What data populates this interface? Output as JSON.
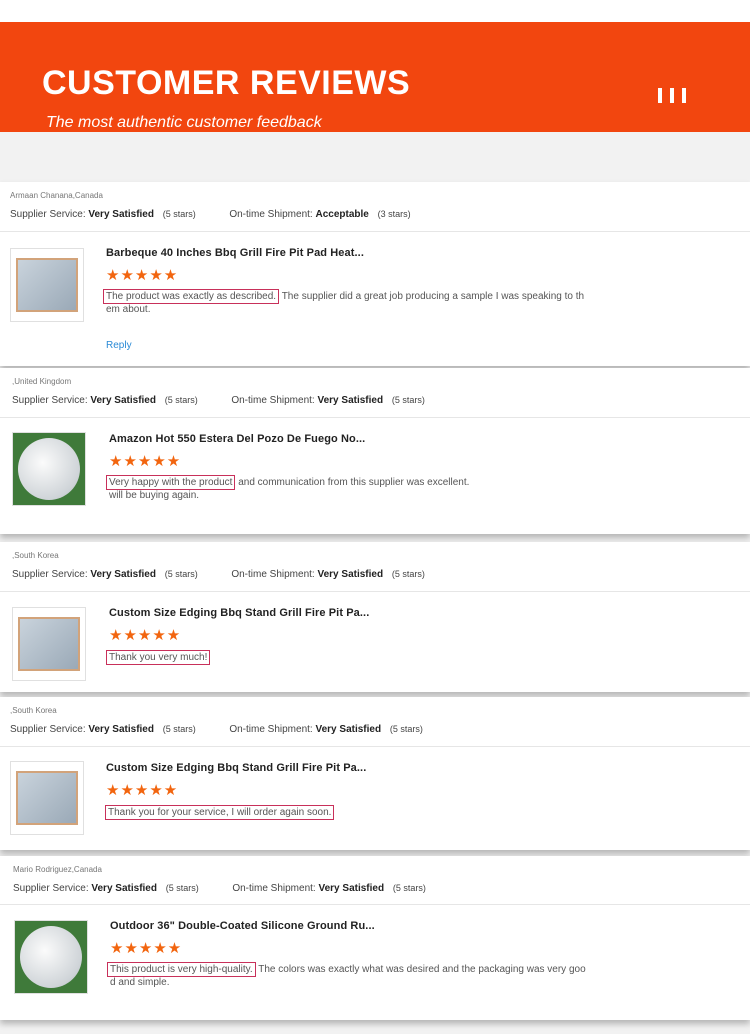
{
  "header": {
    "title": "CUSTOMER REVIEWS",
    "subtitle": "The most authentic customer feedback"
  },
  "labels": {
    "supplier_service": "Supplier Service:",
    "ontime_shipment": "On-time Shipment:"
  },
  "reviews": [
    {
      "reviewer": "Armaan Chanana,Canada",
      "supplier_rating": "Very Satisfied",
      "supplier_stars": "(5 stars)",
      "shipment_rating": "Acceptable",
      "shipment_stars": "(3 stars)",
      "product_title": "Barbeque 40 Inches Bbq Grill Fire Pit Pad Heat...",
      "stars": 5,
      "highlight": "The product was exactly as described.",
      "text_rest": " The supplier did a great job producing a sample I was speaking to th",
      "text_line2": "em about.",
      "reply_label": "Reply",
      "thumb": "square-mat-icon"
    },
    {
      "reviewer": ",United Kingdom",
      "supplier_rating": "Very Satisfied",
      "supplier_stars": "(5 stars)",
      "shipment_rating": "Very Satisfied",
      "shipment_stars": "(5 stars)",
      "product_title": "Amazon Hot 550 Estera Del Pozo De Fuego No...",
      "stars": 5,
      "highlight": "Very happy with the product",
      "text_rest": " and communication from this supplier was excellent.",
      "text_line2": "will be buying again.",
      "thumb": "round-mat-icon"
    },
    {
      "reviewer": ",South Korea",
      "supplier_rating": "Very Satisfied",
      "supplier_stars": "(5 stars)",
      "shipment_rating": "Very Satisfied",
      "shipment_stars": "(5 stars)",
      "product_title": "Custom Size Edging Bbq Stand Grill Fire Pit Pa...",
      "stars": 5,
      "highlight": "Thank you very much!",
      "text_rest": "",
      "text_line2": "",
      "thumb": "square-mat-icon"
    },
    {
      "reviewer": ",South Korea",
      "supplier_rating": "Very Satisfied",
      "supplier_stars": "(5 stars)",
      "shipment_rating": "Very Satisfied",
      "shipment_stars": "(5 stars)",
      "product_title": "Custom Size Edging Bbq Stand Grill Fire Pit Pa...",
      "stars": 5,
      "highlight": "Thank you for your service, I will order again soon.",
      "text_rest": "",
      "text_line2": "",
      "thumb": "square-mat-icon"
    },
    {
      "reviewer": "Mario Rodriguez,Canada",
      "supplier_rating": "Very Satisfied",
      "supplier_stars": "(5 stars)",
      "shipment_rating": "Very Satisfied",
      "shipment_stars": "(5 stars)",
      "product_title": "Outdoor 36\" Double-Coated Silicone Ground Ru...",
      "stars": 5,
      "highlight": "This product is very high-quality.",
      "text_rest": " The colors was exactly what was desired and the packaging was very goo",
      "text_line2": "d and simple.",
      "thumb": "round-mat-icon"
    }
  ],
  "colors": {
    "banner": "#f2460f",
    "star": "#f2650f",
    "highlight_border": "#c8305a",
    "link": "#2a8ad6"
  }
}
